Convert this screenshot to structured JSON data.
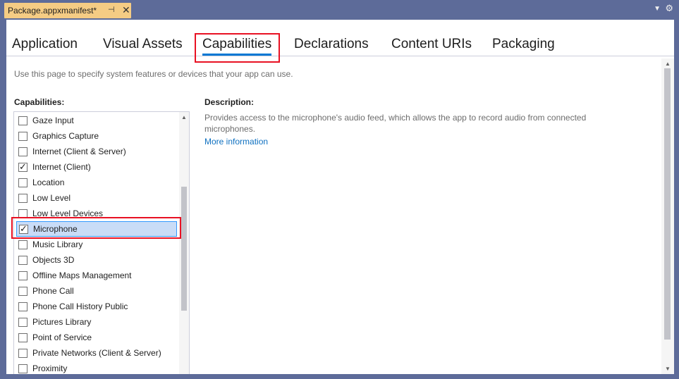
{
  "document_tab": {
    "title": "Package.appxmanifest*",
    "pin_icon": "pin-icon",
    "close_icon": "close-icon"
  },
  "strip": {
    "dropdown_icon": "chevron-down-icon",
    "settings_icon": "gear-icon"
  },
  "nav": {
    "tabs": [
      {
        "label": "Application"
      },
      {
        "label": "Visual Assets"
      },
      {
        "label": "Capabilities"
      },
      {
        "label": "Declarations"
      },
      {
        "label": "Content URIs"
      },
      {
        "label": "Packaging"
      }
    ],
    "active": "Capabilities"
  },
  "page": {
    "hint": "Use this page to specify system features or devices that your app can use.",
    "capabilities_header": "Capabilities:",
    "description_header": "Description:",
    "description_text": "Provides access to the microphone's audio feed, which allows the app to record audio from connected microphones.",
    "more_info": "More information"
  },
  "capabilities": [
    {
      "label": "Gaze Input",
      "checked": false
    },
    {
      "label": "Graphics Capture",
      "checked": false
    },
    {
      "label": "Internet (Client & Server)",
      "checked": false
    },
    {
      "label": "Internet (Client)",
      "checked": true
    },
    {
      "label": "Location",
      "checked": false
    },
    {
      "label": "Low Level",
      "checked": false
    },
    {
      "label": "Low Level Devices",
      "checked": false
    },
    {
      "label": "Microphone",
      "checked": true,
      "selected": true
    },
    {
      "label": "Music Library",
      "checked": false
    },
    {
      "label": "Objects 3D",
      "checked": false
    },
    {
      "label": "Offline Maps Management",
      "checked": false
    },
    {
      "label": "Phone Call",
      "checked": false
    },
    {
      "label": "Phone Call History Public",
      "checked": false
    },
    {
      "label": "Pictures Library",
      "checked": false
    },
    {
      "label": "Point of Service",
      "checked": false
    },
    {
      "label": "Private Networks (Client & Server)",
      "checked": false
    },
    {
      "label": "Proximity",
      "checked": false
    }
  ],
  "colors": {
    "frame": "#5d6b99",
    "tab_active": "#f5cc84",
    "accent": "#0078d4",
    "highlight": "#e81123",
    "selection": "#c9dcf7",
    "link": "#0e70c0"
  }
}
